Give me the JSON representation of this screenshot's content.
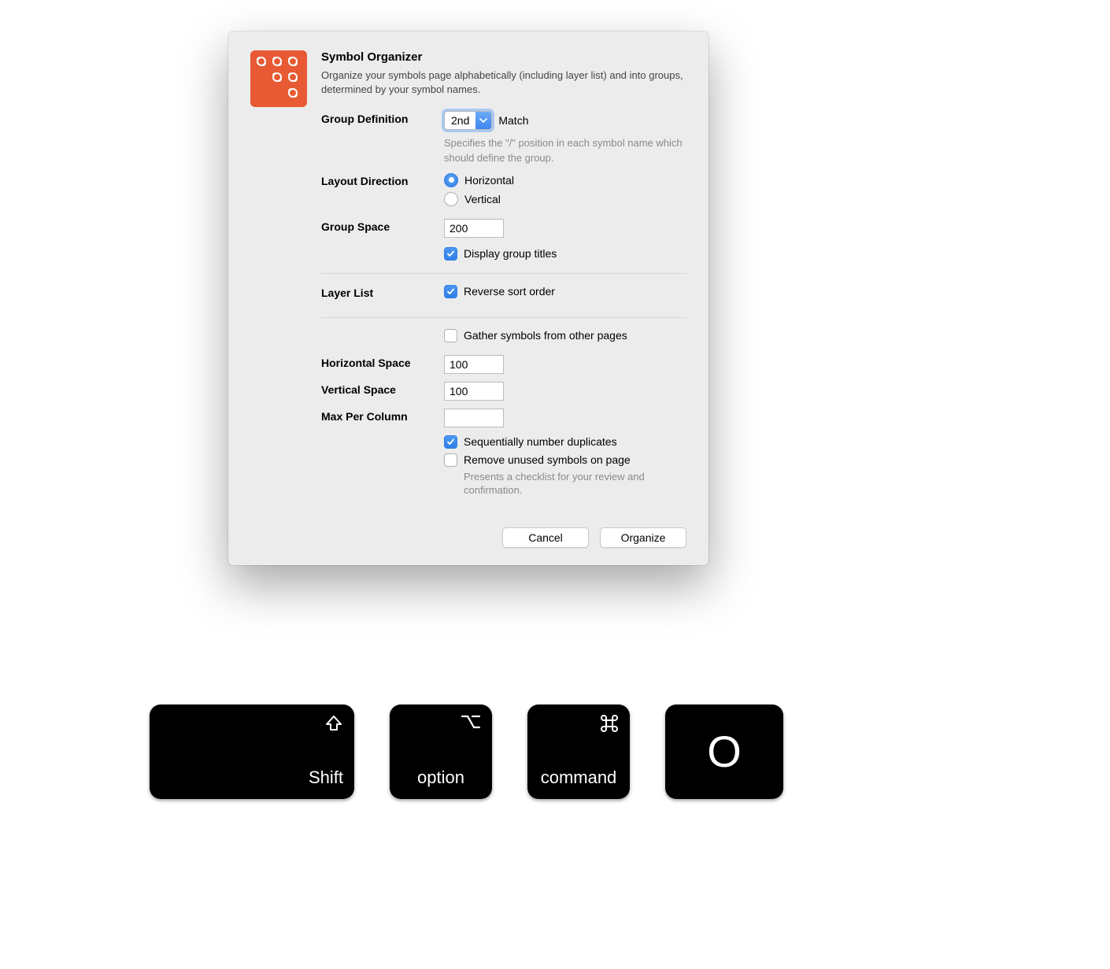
{
  "dialog": {
    "title": "Symbol Organizer",
    "description": "Organize your symbols page alphabetically (including layer list) and into groups, determined by your symbol names.",
    "groupDefinition": {
      "label": "Group Definition",
      "selectValue": "2nd",
      "matchLabel": "Match",
      "hint": "Specifies the \"/\" position in each symbol name which should define the group."
    },
    "layoutDirection": {
      "label": "Layout Direction",
      "horizontal": "Horizontal",
      "vertical": "Vertical"
    },
    "groupSpace": {
      "label": "Group Space",
      "value": "200",
      "displayTitles": "Display group titles"
    },
    "layerList": {
      "label": "Layer List",
      "reverseSort": "Reverse sort order"
    },
    "gatherSymbols": "Gather symbols from other pages",
    "horizontalSpace": {
      "label": "Horizontal Space",
      "value": "100"
    },
    "verticalSpace": {
      "label": "Vertical Space",
      "value": "100"
    },
    "maxPerColumn": {
      "label": "Max Per Column",
      "value": ""
    },
    "seqNumber": "Sequentially number duplicates",
    "removeUnused": {
      "label": "Remove unused symbols on page",
      "hint": "Presents a checklist for your review and confirmation."
    },
    "cancelLabel": "Cancel",
    "organizeLabel": "Organize"
  },
  "keys": {
    "shift": "Shift",
    "option": "option",
    "command": "command",
    "letter": "O"
  }
}
